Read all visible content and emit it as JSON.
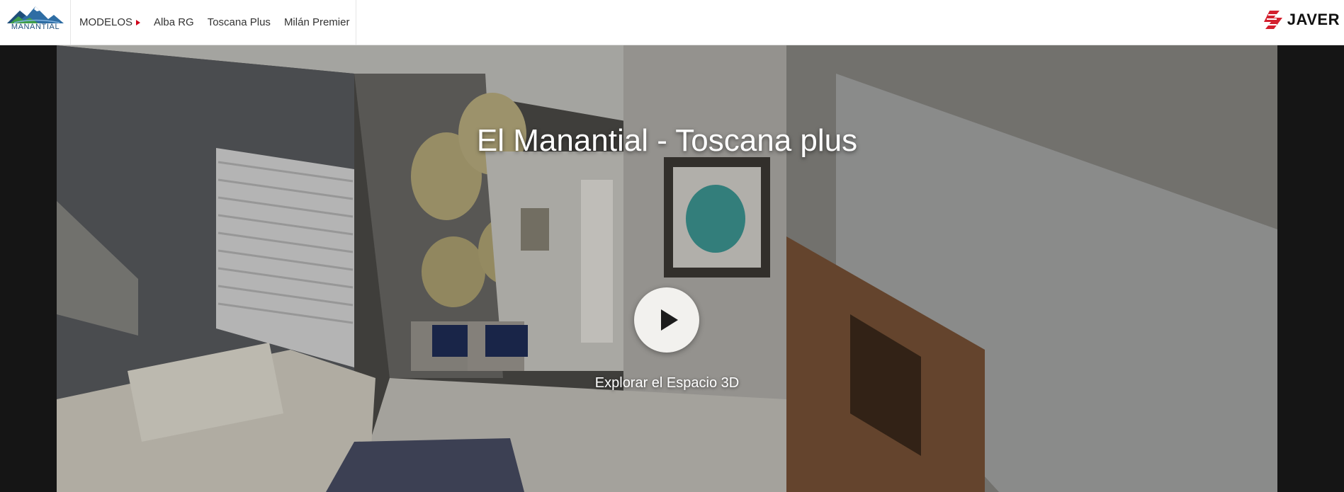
{
  "header": {
    "logo_text": "MANANTIAL",
    "nav": {
      "models_label": "MODELOS",
      "items": [
        "Alba RG",
        "Toscana Plus",
        "Milán Premier"
      ]
    },
    "brand_text": "JAVER"
  },
  "hero": {
    "title": "El Manantial - Toscana plus",
    "explore_label": "Explorar el Espacio 3D"
  },
  "colors": {
    "accent": "#d0021b",
    "logo_blue": "#1f4e79",
    "page_bg": "#151515"
  },
  "icons": [
    "manantial-mountain-logo-icon",
    "caret-right-icon",
    "javer-logo-icon",
    "play-icon"
  ]
}
